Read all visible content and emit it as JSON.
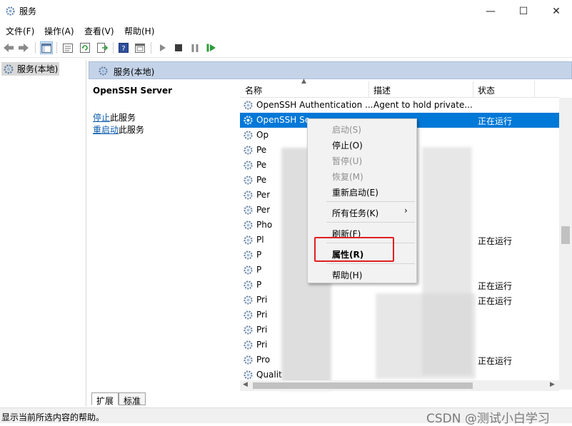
{
  "window": {
    "title": "服务",
    "minimize": "—",
    "maximize": "☐",
    "close": "✕"
  },
  "menubar": [
    "文件(F)",
    "操作(A)",
    "查看(V)",
    "帮助(H)"
  ],
  "tree": {
    "root_label": "服务(本地)"
  },
  "panel": {
    "header_label": "服务(本地)",
    "service_title": "OpenSSH Server",
    "stop_link": "停止",
    "stop_suffix": "此服务",
    "restart_link": "重启动",
    "restart_suffix": "此服务"
  },
  "table": {
    "columns": [
      "名称",
      "描述",
      "状态"
    ],
    "rows": [
      {
        "name": "OpenSSH Authentication ...",
        "desc": "Agent to hold private...",
        "status": ""
      },
      {
        "name": "OpenSSH Se",
        "desc": "",
        "status": "正在运行",
        "selected": true
      },
      {
        "name": "Op",
        "desc": "",
        "status": ""
      },
      {
        "name": "Pe",
        "desc": "",
        "status": ""
      },
      {
        "name": "Pe",
        "desc": "",
        "status": ""
      },
      {
        "name": "Pe",
        "desc": "",
        "status": ""
      },
      {
        "name": "Per",
        "desc": "",
        "status": ""
      },
      {
        "name": "Per",
        "desc": "",
        "status": ""
      },
      {
        "name": "Pho",
        "desc": "",
        "status": ""
      },
      {
        "name": "Pl",
        "desc": "",
        "status": "正在运行"
      },
      {
        "name": "P",
        "desc": "",
        "status": ""
      },
      {
        "name": "P",
        "desc": "",
        "status": ""
      },
      {
        "name": "P",
        "desc": "",
        "status": "正在运行"
      },
      {
        "name": "Pri",
        "desc": "",
        "status": "正在运行"
      },
      {
        "name": "Pri",
        "desc": "",
        "status": ""
      },
      {
        "name": "Pri",
        "desc": "",
        "status": ""
      },
      {
        "name": "Pri",
        "desc": "",
        "status": ""
      },
      {
        "name": "Pro",
        "desc": "",
        "status": "正在运行"
      },
      {
        "name": "Qualit",
        "desc": "",
        "status": ""
      }
    ]
  },
  "context_menu": {
    "start": "启动(S)",
    "stop": "停止(O)",
    "pause": "暂停(U)",
    "resume": "恢复(M)",
    "restart": "重新启动(E)",
    "all_tasks": "所有任务(K)",
    "refresh": "刷新(F)",
    "properties": "属性(R)",
    "help": "帮助(H)"
  },
  "tabs": [
    "扩展",
    "标准"
  ],
  "statusbar": {
    "text": "显示当前所选内容的帮助。",
    "watermark": "CSDN @测试小白学习"
  },
  "colors": {
    "selection": "#0078d7",
    "highlight_box": "#e02020",
    "link": "#0b5cad"
  }
}
